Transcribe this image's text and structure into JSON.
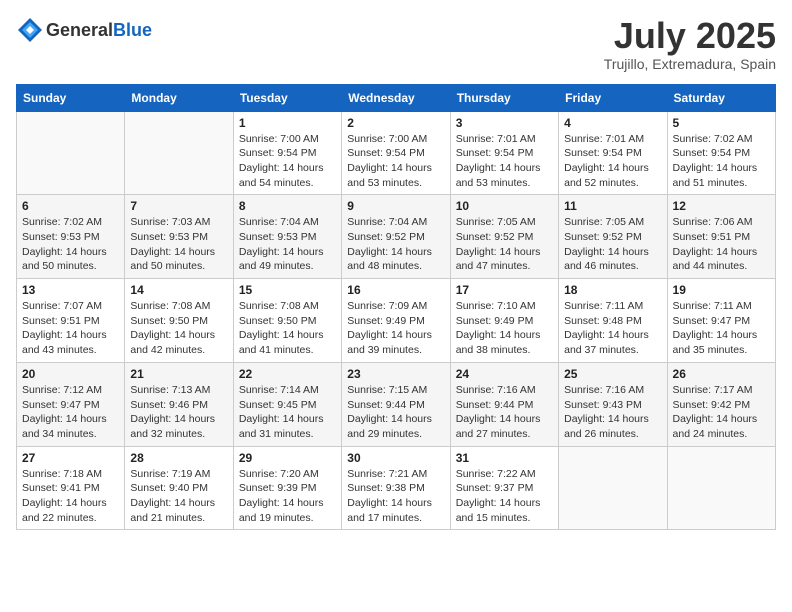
{
  "header": {
    "logo_general": "General",
    "logo_blue": "Blue",
    "month": "July 2025",
    "location": "Trujillo, Extremadura, Spain"
  },
  "columns": [
    "Sunday",
    "Monday",
    "Tuesday",
    "Wednesday",
    "Thursday",
    "Friday",
    "Saturday"
  ],
  "weeks": [
    [
      {
        "day": "",
        "info": ""
      },
      {
        "day": "",
        "info": ""
      },
      {
        "day": "1",
        "info": "Sunrise: 7:00 AM\nSunset: 9:54 PM\nDaylight: 14 hours and 54 minutes."
      },
      {
        "day": "2",
        "info": "Sunrise: 7:00 AM\nSunset: 9:54 PM\nDaylight: 14 hours and 53 minutes."
      },
      {
        "day": "3",
        "info": "Sunrise: 7:01 AM\nSunset: 9:54 PM\nDaylight: 14 hours and 53 minutes."
      },
      {
        "day": "4",
        "info": "Sunrise: 7:01 AM\nSunset: 9:54 PM\nDaylight: 14 hours and 52 minutes."
      },
      {
        "day": "5",
        "info": "Sunrise: 7:02 AM\nSunset: 9:54 PM\nDaylight: 14 hours and 51 minutes."
      }
    ],
    [
      {
        "day": "6",
        "info": "Sunrise: 7:02 AM\nSunset: 9:53 PM\nDaylight: 14 hours and 50 minutes."
      },
      {
        "day": "7",
        "info": "Sunrise: 7:03 AM\nSunset: 9:53 PM\nDaylight: 14 hours and 50 minutes."
      },
      {
        "day": "8",
        "info": "Sunrise: 7:04 AM\nSunset: 9:53 PM\nDaylight: 14 hours and 49 minutes."
      },
      {
        "day": "9",
        "info": "Sunrise: 7:04 AM\nSunset: 9:52 PM\nDaylight: 14 hours and 48 minutes."
      },
      {
        "day": "10",
        "info": "Sunrise: 7:05 AM\nSunset: 9:52 PM\nDaylight: 14 hours and 47 minutes."
      },
      {
        "day": "11",
        "info": "Sunrise: 7:05 AM\nSunset: 9:52 PM\nDaylight: 14 hours and 46 minutes."
      },
      {
        "day": "12",
        "info": "Sunrise: 7:06 AM\nSunset: 9:51 PM\nDaylight: 14 hours and 44 minutes."
      }
    ],
    [
      {
        "day": "13",
        "info": "Sunrise: 7:07 AM\nSunset: 9:51 PM\nDaylight: 14 hours and 43 minutes."
      },
      {
        "day": "14",
        "info": "Sunrise: 7:08 AM\nSunset: 9:50 PM\nDaylight: 14 hours and 42 minutes."
      },
      {
        "day": "15",
        "info": "Sunrise: 7:08 AM\nSunset: 9:50 PM\nDaylight: 14 hours and 41 minutes."
      },
      {
        "day": "16",
        "info": "Sunrise: 7:09 AM\nSunset: 9:49 PM\nDaylight: 14 hours and 39 minutes."
      },
      {
        "day": "17",
        "info": "Sunrise: 7:10 AM\nSunset: 9:49 PM\nDaylight: 14 hours and 38 minutes."
      },
      {
        "day": "18",
        "info": "Sunrise: 7:11 AM\nSunset: 9:48 PM\nDaylight: 14 hours and 37 minutes."
      },
      {
        "day": "19",
        "info": "Sunrise: 7:11 AM\nSunset: 9:47 PM\nDaylight: 14 hours and 35 minutes."
      }
    ],
    [
      {
        "day": "20",
        "info": "Sunrise: 7:12 AM\nSunset: 9:47 PM\nDaylight: 14 hours and 34 minutes."
      },
      {
        "day": "21",
        "info": "Sunrise: 7:13 AM\nSunset: 9:46 PM\nDaylight: 14 hours and 32 minutes."
      },
      {
        "day": "22",
        "info": "Sunrise: 7:14 AM\nSunset: 9:45 PM\nDaylight: 14 hours and 31 minutes."
      },
      {
        "day": "23",
        "info": "Sunrise: 7:15 AM\nSunset: 9:44 PM\nDaylight: 14 hours and 29 minutes."
      },
      {
        "day": "24",
        "info": "Sunrise: 7:16 AM\nSunset: 9:44 PM\nDaylight: 14 hours and 27 minutes."
      },
      {
        "day": "25",
        "info": "Sunrise: 7:16 AM\nSunset: 9:43 PM\nDaylight: 14 hours and 26 minutes."
      },
      {
        "day": "26",
        "info": "Sunrise: 7:17 AM\nSunset: 9:42 PM\nDaylight: 14 hours and 24 minutes."
      }
    ],
    [
      {
        "day": "27",
        "info": "Sunrise: 7:18 AM\nSunset: 9:41 PM\nDaylight: 14 hours and 22 minutes."
      },
      {
        "day": "28",
        "info": "Sunrise: 7:19 AM\nSunset: 9:40 PM\nDaylight: 14 hours and 21 minutes."
      },
      {
        "day": "29",
        "info": "Sunrise: 7:20 AM\nSunset: 9:39 PM\nDaylight: 14 hours and 19 minutes."
      },
      {
        "day": "30",
        "info": "Sunrise: 7:21 AM\nSunset: 9:38 PM\nDaylight: 14 hours and 17 minutes."
      },
      {
        "day": "31",
        "info": "Sunrise: 7:22 AM\nSunset: 9:37 PM\nDaylight: 14 hours and 15 minutes."
      },
      {
        "day": "",
        "info": ""
      },
      {
        "day": "",
        "info": ""
      }
    ]
  ]
}
